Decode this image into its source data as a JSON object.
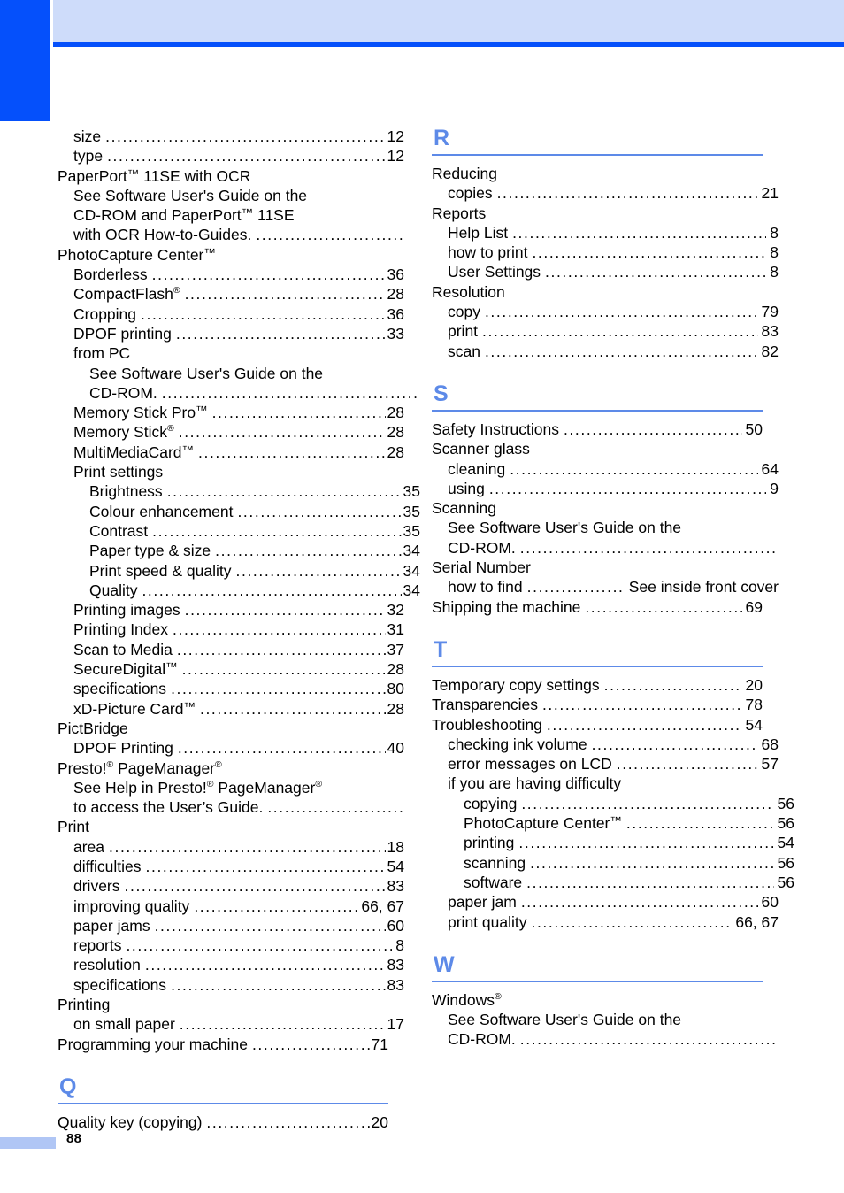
{
  "document": {
    "page_number": "88",
    "accent_blue": "#0550fb",
    "band_blue": "#cedcfa",
    "letter_blue": "#5d8ae8",
    "footer_blue": "#b0c6f5"
  },
  "columns": [
    {
      "id": "left",
      "blocks": [
        {
          "type": "entries",
          "entries": [
            {
              "level": 1,
              "label": "size",
              "page": "12",
              "leader": true
            },
            {
              "level": 1,
              "label": "type",
              "page": "12",
              "leader": true
            },
            {
              "level": 0,
              "label": "PaperPort™ 11SE with OCR",
              "page": "",
              "leader": false
            },
            {
              "level": 1,
              "label": "See Software User's Guide on the",
              "page": "",
              "leader": false
            },
            {
              "level": 1,
              "label": "CD-ROM and PaperPort™ 11SE",
              "page": "",
              "leader": false
            },
            {
              "level": 1,
              "label": "with OCR How-to-Guides.",
              "page": "",
              "leader": true
            },
            {
              "level": 0,
              "label": "PhotoCapture Center™",
              "page": "",
              "leader": false
            },
            {
              "level": 1,
              "label": "Borderless",
              "page": "36",
              "leader": true
            },
            {
              "level": 1,
              "label": "CompactFlash®",
              "page": "28",
              "leader": true
            },
            {
              "level": 1,
              "label": "Cropping",
              "page": "36",
              "leader": true
            },
            {
              "level": 1,
              "label": "DPOF printing",
              "page": "33",
              "leader": true
            },
            {
              "level": 1,
              "label": "from PC",
              "page": "",
              "leader": false
            },
            {
              "level": 2,
              "label": "See Software User's Guide on the",
              "page": "",
              "leader": false
            },
            {
              "level": 2,
              "label": "CD-ROM.",
              "page": "",
              "leader": true
            },
            {
              "level": 1,
              "label": "Memory Stick Pro™",
              "page": "28",
              "leader": true
            },
            {
              "level": 1,
              "label": "Memory Stick®",
              "page": "28",
              "leader": true
            },
            {
              "level": 1,
              "label": "MultiMediaCard™",
              "page": "28",
              "leader": true
            },
            {
              "level": 1,
              "label": "Print settings",
              "page": "",
              "leader": false
            },
            {
              "level": 2,
              "label": "Brightness",
              "page": "35",
              "leader": true
            },
            {
              "level": 2,
              "label": "Colour enhancement",
              "page": "35",
              "leader": true
            },
            {
              "level": 2,
              "label": "Contrast",
              "page": "35",
              "leader": true
            },
            {
              "level": 2,
              "label": "Paper type & size",
              "page": "34",
              "leader": true
            },
            {
              "level": 2,
              "label": "Print speed & quality",
              "page": "34",
              "leader": true
            },
            {
              "level": 2,
              "label": "Quality",
              "page": "34",
              "leader": true
            },
            {
              "level": 1,
              "label": "Printing images",
              "page": "32",
              "leader": true
            },
            {
              "level": 1,
              "label": "Printing Index",
              "page": "31",
              "leader": true
            },
            {
              "level": 1,
              "label": "Scan to Media",
              "page": "37",
              "leader": true
            },
            {
              "level": 1,
              "label": "SecureDigital™",
              "page": "28",
              "leader": true
            },
            {
              "level": 1,
              "label": "specifications",
              "page": "80",
              "leader": true
            },
            {
              "level": 1,
              "label": "xD-Picture Card™",
              "page": "28",
              "leader": true
            },
            {
              "level": 0,
              "label": "PictBridge",
              "page": "",
              "leader": false
            },
            {
              "level": 1,
              "label": "DPOF Printing",
              "page": "40",
              "leader": true
            },
            {
              "level": 0,
              "label": "Presto!® PageManager®",
              "page": "",
              "leader": false
            },
            {
              "level": 1,
              "label": "See Help in Presto!® PageManager®",
              "page": "",
              "leader": false
            },
            {
              "level": 1,
              "label": "to access the User’s Guide.",
              "page": "",
              "leader": true
            },
            {
              "level": 0,
              "label": "Print",
              "page": "",
              "leader": false
            },
            {
              "level": 1,
              "label": "area",
              "page": "18",
              "leader": true
            },
            {
              "level": 1,
              "label": "difficulties",
              "page": "54",
              "leader": true
            },
            {
              "level": 1,
              "label": "drivers",
              "page": "83",
              "leader": true
            },
            {
              "level": 1,
              "label": "improving quality",
              "page": "66, 67",
              "leader": true
            },
            {
              "level": 1,
              "label": "paper jams",
              "page": "60",
              "leader": true
            },
            {
              "level": 1,
              "label": "reports",
              "page": "8",
              "leader": true
            },
            {
              "level": 1,
              "label": "resolution",
              "page": "83",
              "leader": true
            },
            {
              "level": 1,
              "label": "specifications",
              "page": "83",
              "leader": true
            },
            {
              "level": 0,
              "label": "Printing",
              "page": "",
              "leader": false
            },
            {
              "level": 1,
              "label": "on small paper",
              "page": "17",
              "leader": true
            },
            {
              "level": 0,
              "label": "Programming your machine",
              "page": "71",
              "leader": true
            }
          ]
        },
        {
          "type": "section",
          "letter": "Q",
          "entries": [
            {
              "level": 0,
              "label": "Quality key (copying)",
              "page": "20",
              "leader": true
            }
          ]
        }
      ]
    },
    {
      "id": "right",
      "blocks": [
        {
          "type": "section",
          "letter": "R",
          "first": true,
          "entries": [
            {
              "level": 0,
              "label": "Reducing",
              "page": "",
              "leader": false
            },
            {
              "level": 1,
              "label": "copies",
              "page": "21",
              "leader": true
            },
            {
              "level": 0,
              "label": "Reports",
              "page": "",
              "leader": false
            },
            {
              "level": 1,
              "label": "Help List",
              "page": "8",
              "leader": true
            },
            {
              "level": 1,
              "label": "how to print",
              "page": "8",
              "leader": true
            },
            {
              "level": 1,
              "label": "User Settings",
              "page": "8",
              "leader": true
            },
            {
              "level": 0,
              "label": "Resolution",
              "page": "",
              "leader": false
            },
            {
              "level": 1,
              "label": "copy",
              "page": "79",
              "leader": true
            },
            {
              "level": 1,
              "label": "print",
              "page": "83",
              "leader": true
            },
            {
              "level": 1,
              "label": "scan",
              "page": "82",
              "leader": true
            }
          ]
        },
        {
          "type": "section",
          "letter": "S",
          "entries": [
            {
              "level": 0,
              "label": "Safety Instructions",
              "page": "50",
              "leader": true
            },
            {
              "level": 0,
              "label": "Scanner glass",
              "page": "",
              "leader": false
            },
            {
              "level": 1,
              "label": "cleaning",
              "page": "64",
              "leader": true
            },
            {
              "level": 1,
              "label": "using",
              "page": "9",
              "leader": true
            },
            {
              "level": 0,
              "label": "Scanning",
              "page": "",
              "leader": false
            },
            {
              "level": 1,
              "label": "See Software User's Guide on the",
              "page": "",
              "leader": false
            },
            {
              "level": 1,
              "label": "CD-ROM.",
              "page": "",
              "leader": true
            },
            {
              "level": 0,
              "label": "Serial Number",
              "page": "",
              "leader": false
            },
            {
              "level": 1,
              "label": "how to find",
              "page": "See inside front cover",
              "leader": true
            },
            {
              "level": 0,
              "label": "Shipping the machine",
              "page": "69",
              "leader": true
            }
          ]
        },
        {
          "type": "section",
          "letter": "T",
          "entries": [
            {
              "level": 0,
              "label": "Temporary copy settings",
              "page": "20",
              "leader": true
            },
            {
              "level": 0,
              "label": "Transparencies",
              "page": "78",
              "leader": true
            },
            {
              "level": 0,
              "label": "Troubleshooting",
              "page": "54",
              "leader": true
            },
            {
              "level": 1,
              "label": "checking ink volume",
              "page": "68",
              "leader": true
            },
            {
              "level": 1,
              "label": "error messages on LCD",
              "page": "57",
              "leader": true
            },
            {
              "level": 1,
              "label": "if you are having difficulty",
              "page": "",
              "leader": false
            },
            {
              "level": 2,
              "label": "copying",
              "page": "56",
              "leader": true
            },
            {
              "level": 2,
              "label": "PhotoCapture Center™",
              "page": "56",
              "leader": true
            },
            {
              "level": 2,
              "label": "printing",
              "page": "54",
              "leader": true
            },
            {
              "level": 2,
              "label": "scanning",
              "page": "56",
              "leader": true
            },
            {
              "level": 2,
              "label": "software",
              "page": "56",
              "leader": true
            },
            {
              "level": 1,
              "label": "paper jam",
              "page": "60",
              "leader": true
            },
            {
              "level": 1,
              "label": "print quality",
              "page": "66, 67",
              "leader": true
            }
          ]
        },
        {
          "type": "section",
          "letter": "W",
          "entries": [
            {
              "level": 0,
              "label": "Windows®",
              "page": "",
              "leader": false
            },
            {
              "level": 1,
              "label": "See Software User's Guide on the",
              "page": "",
              "leader": false
            },
            {
              "level": 1,
              "label": "CD-ROM.",
              "page": "",
              "leader": true
            }
          ]
        }
      ]
    }
  ]
}
